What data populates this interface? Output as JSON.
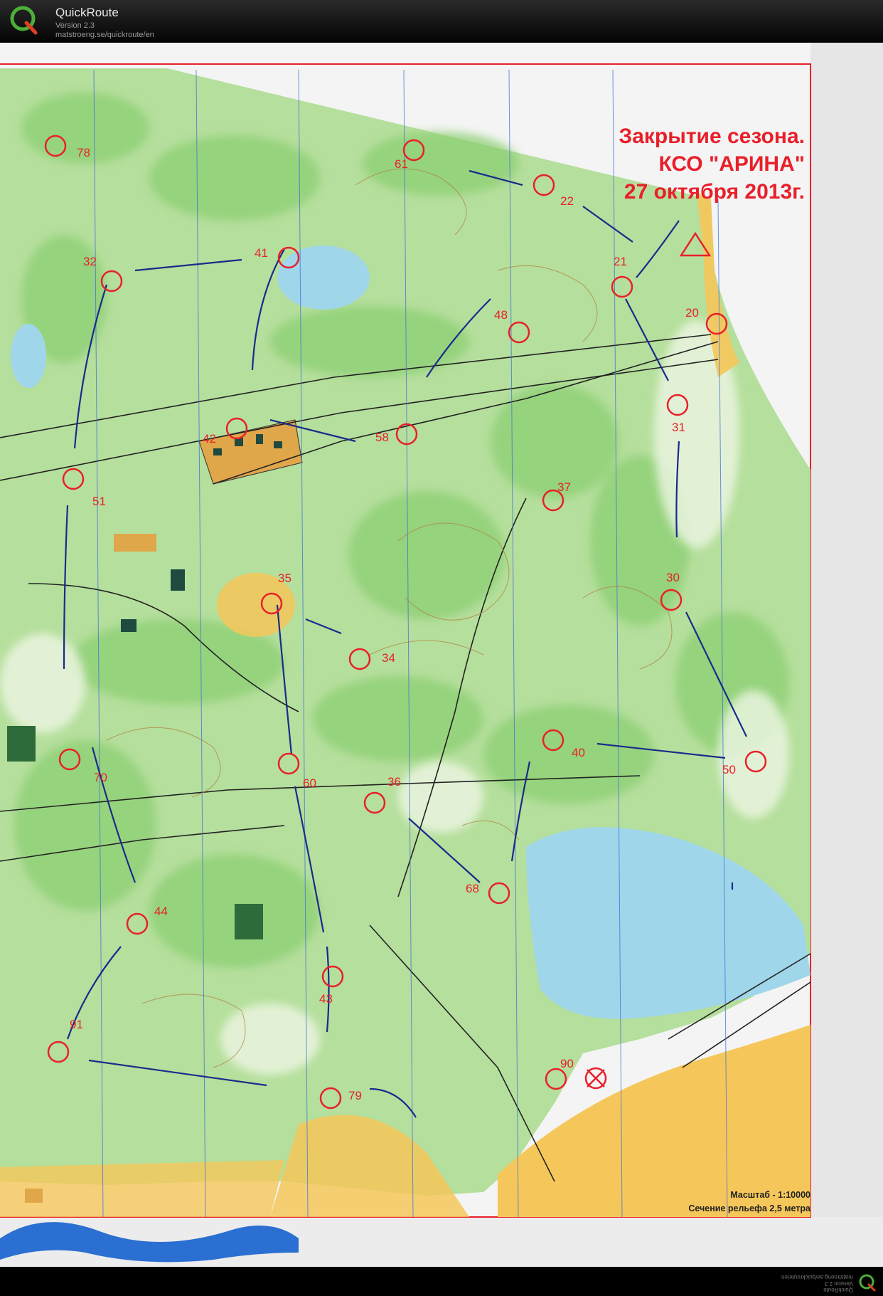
{
  "app": {
    "name": "QuickRoute",
    "version": "Version 2.3",
    "url": "matstroeng.se/quickroute/en"
  },
  "map": {
    "title_lines": [
      "Закрытие сезона.",
      "КСО \"АРИНА\"",
      "27 октября 2013г."
    ],
    "scale": "Масштаб - 1:10000",
    "contour_interval": "Сечение рельефа 2,5 метра",
    "colors": {
      "control": "#e8202a",
      "route": "#1a2a8c",
      "forest": "#b5df9c",
      "open_land": "#f5c75a",
      "water": "#9fd6ea",
      "meridian": "#3a6fd8"
    },
    "start_symbol": "triangle-start",
    "finish_symbol": "x-finish"
  },
  "controls": [
    {
      "code": "78"
    },
    {
      "code": "61"
    },
    {
      "code": "22"
    },
    {
      "code": "32"
    },
    {
      "code": "41"
    },
    {
      "code": "21"
    },
    {
      "code": "48"
    },
    {
      "code": "20"
    },
    {
      "code": "42"
    },
    {
      "code": "58"
    },
    {
      "code": "31"
    },
    {
      "code": "51"
    },
    {
      "code": "37"
    },
    {
      "code": "35"
    },
    {
      "code": "30"
    },
    {
      "code": "34"
    },
    {
      "code": "70"
    },
    {
      "code": "40"
    },
    {
      "code": "50"
    },
    {
      "code": "60"
    },
    {
      "code": "36"
    },
    {
      "code": "68"
    },
    {
      "code": "44"
    },
    {
      "code": "43"
    },
    {
      "code": "91"
    },
    {
      "code": "90"
    },
    {
      "code": "79"
    }
  ],
  "footer": {
    "line1": "QuickRoute",
    "line2": "Version 2.3",
    "line3": "matstroeng.se/quickroute/en"
  }
}
